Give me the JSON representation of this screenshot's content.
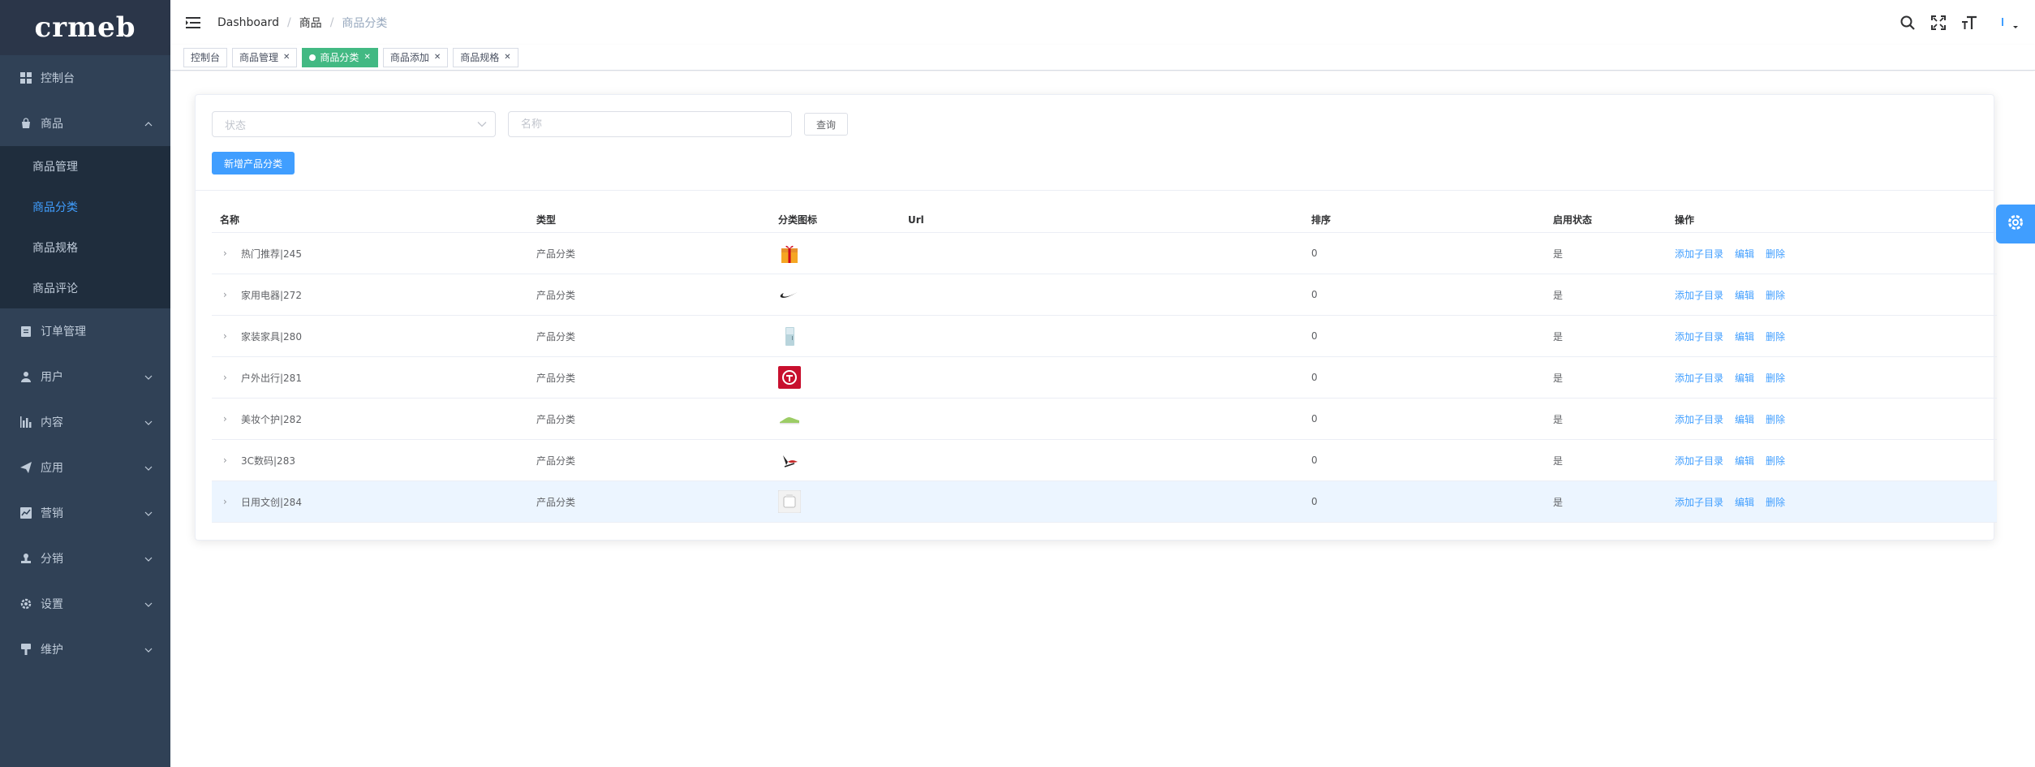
{
  "brand": {
    "logo": "crmeb"
  },
  "sidebar": {
    "items": [
      {
        "label": "控制台",
        "icon": "dashboard-icon",
        "has_chevron": false
      },
      {
        "label": "商品",
        "icon": "shop-bag-icon",
        "has_chevron": true,
        "expanded": true,
        "children": [
          {
            "label": "商品管理",
            "active": false
          },
          {
            "label": "商品分类",
            "active": true
          },
          {
            "label": "商品规格",
            "active": false
          },
          {
            "label": "商品评论",
            "active": false
          }
        ]
      },
      {
        "label": "订单管理",
        "icon": "clipboard-icon",
        "has_chevron": false
      },
      {
        "label": "用户",
        "icon": "user-icon",
        "has_chevron": true
      },
      {
        "label": "内容",
        "icon": "chart-icon",
        "has_chevron": true
      },
      {
        "label": "应用",
        "icon": "send-icon",
        "has_chevron": true
      },
      {
        "label": "营销",
        "icon": "trend-icon",
        "has_chevron": true
      },
      {
        "label": "分销",
        "icon": "stamp-icon",
        "has_chevron": true
      },
      {
        "label": "设置",
        "icon": "gear-icon",
        "has_chevron": true
      },
      {
        "label": "维护",
        "icon": "brush-icon",
        "has_chevron": true
      }
    ]
  },
  "breadcrumb": [
    "Dashboard",
    "商品",
    "商品分类"
  ],
  "tags": [
    {
      "label": "控制台",
      "active": false,
      "closable": false
    },
    {
      "label": "商品管理",
      "active": false,
      "closable": true
    },
    {
      "label": "商品分类",
      "active": true,
      "closable": true
    },
    {
      "label": "商品添加",
      "active": false,
      "closable": true
    },
    {
      "label": "商品规格",
      "active": false,
      "closable": true
    }
  ],
  "filters": {
    "status_placeholder": "状态",
    "name_placeholder": "名称",
    "query_label": "查询",
    "add_label": "新增产品分类"
  },
  "table": {
    "headers": [
      "名称",
      "类型",
      "分类图标",
      "Url",
      "排序",
      "启用状态",
      "操作"
    ],
    "rows": [
      {
        "name": "热门推荐|245",
        "type": "产品分类",
        "icon": "gift-box-icon",
        "url": "",
        "sort": "0",
        "status": "是"
      },
      {
        "name": "家用电器|272",
        "type": "产品分类",
        "icon": "nike-logo-icon",
        "url": "",
        "sort": "0",
        "status": "是"
      },
      {
        "name": "家装家具|280",
        "type": "产品分类",
        "icon": "fridge-icon",
        "url": "",
        "sort": "0",
        "status": "是"
      },
      {
        "name": "户外出行|281",
        "type": "产品分类",
        "icon": "red-badge-icon",
        "url": "",
        "sort": "0",
        "status": "是"
      },
      {
        "name": "美妆个护|282",
        "type": "产品分类",
        "icon": "sneaker-icon",
        "url": "",
        "sort": "0",
        "status": "是"
      },
      {
        "name": "3C数码|283",
        "type": "产品分类",
        "icon": "bird-icon",
        "url": "",
        "sort": "0",
        "status": "是"
      },
      {
        "name": "日用文创|284",
        "type": "产品分类",
        "icon": "cube-box-icon",
        "url": "",
        "sort": "0",
        "status": "是"
      }
    ],
    "ops": [
      "添加子目录",
      "编辑",
      "删除"
    ]
  },
  "colors": {
    "sidebar_bg": "#304156",
    "submenu_bg": "#1f2d3d",
    "accent": "#409eff",
    "active_tag": "#42b983"
  }
}
